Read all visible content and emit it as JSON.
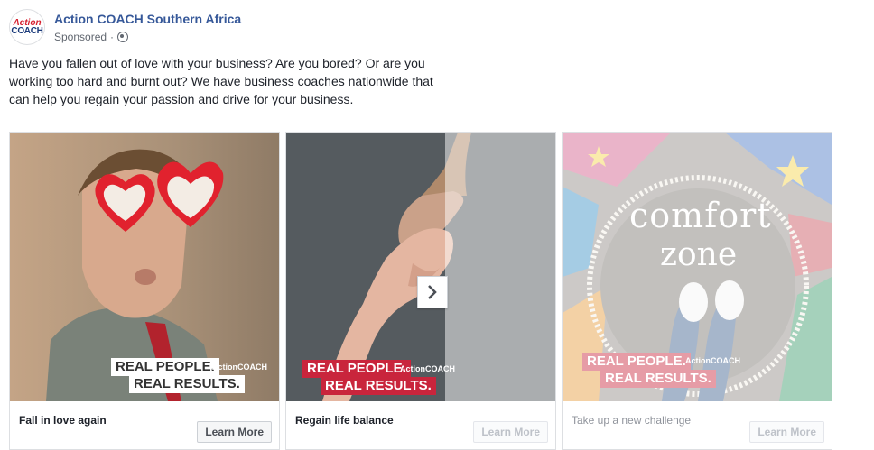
{
  "post": {
    "logo_text": [
      "Action",
      "COACH"
    ],
    "page_name": "Action COACH Southern Africa",
    "sponsored": "Sponsored",
    "separator": "·",
    "body": "Have you fallen out of love with your business? Are you bored? Or are you working too hard and burnt out? We have business coaches nationwide that can help you regain your passion and drive for your business."
  },
  "cards": [
    {
      "title": "Fall in love again",
      "cta": "Learn More",
      "banner": [
        "REAL PEOPLE.",
        "REAL RESULTS."
      ],
      "logo": "ActionCOACH"
    },
    {
      "title": "Regain life balance",
      "cta": "Learn More",
      "banner": [
        "REAL PEOPLE.",
        "REAL RESULTS."
      ],
      "logo": "ActionCOACH"
    },
    {
      "title": "Take up a new challenge",
      "cta": "Learn More",
      "banner": [
        "REAL PEOPLE.",
        "REAL RESULTS."
      ],
      "logo": "ActionCOACH",
      "chalk": [
        "comfort",
        "zone"
      ]
    }
  ],
  "icons": {
    "globe": "globe-icon",
    "next": "chevron-right-icon"
  },
  "colors": {
    "link": "#365899",
    "brand_red": "#c9253c",
    "text": "#1d2129"
  }
}
